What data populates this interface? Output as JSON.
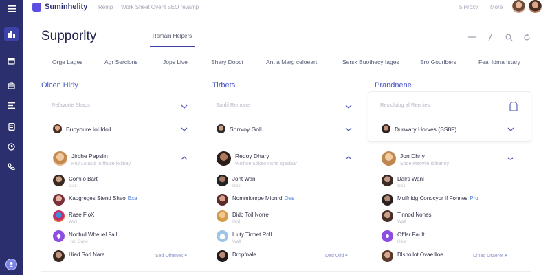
{
  "app": {
    "name": "Suminhelity"
  },
  "topbar": {
    "links": [
      "Remp",
      "Work Sheet Overit SEO revamp"
    ],
    "right_links": [
      "5 Proxy",
      "More"
    ]
  },
  "header": {
    "title": "Supporlty",
    "active_tab": "Remain Helpers"
  },
  "categories": [
    "Orge Lages",
    "Agr Sercions",
    "Jops Live",
    "Shary Dooct",
    "Ant a Marg celoeart",
    "Sersk Buothecy Iages",
    "Sro Gourlbers",
    "Feal Idma Istary"
  ],
  "columns": [
    {
      "title": "Oicen Hirly",
      "search_placeholder": "Refavorte Shaps",
      "selected": "Bupyoure Iol Idoil",
      "lead": {
        "name": "Jirche Pepsiin",
        "sub": "Poy Lolasis Iorlhuse lolilhay"
      },
      "members": [
        {
          "name": "Comilo Bart",
          "sub": "Gall",
          "tag": ""
        },
        {
          "name": "Kaogreges Stend Sheo",
          "sub": "",
          "tag": "Exa"
        },
        {
          "name": "Rase FloX",
          "sub": "Wall",
          "tag": ""
        },
        {
          "name": "Nodfud Wheuel Fall",
          "sub": "Hail Calle",
          "tag": ""
        },
        {
          "name": "Hiad Sod Nare",
          "sub": "",
          "tag": ""
        }
      ],
      "footer_link": "Sed Olhenes"
    },
    {
      "title": "Tirbets",
      "search_placeholder": "Sanfil Remone",
      "selected": "Sorrvoy Goll",
      "lead": {
        "name": "Redoy Dhary",
        "sub": "Wolhce Sokeo Ilwho Igaslaar"
      },
      "members": [
        {
          "name": "Jont Wanl",
          "sub": "Gall",
          "tag": ""
        },
        {
          "name": "Nommionrpe Mionrd",
          "sub": "",
          "tag": "Oas"
        },
        {
          "name": "Dido Toil Norre",
          "sub": "Ierd",
          "tag": ""
        },
        {
          "name": "Liuty Tirmet Roll",
          "sub": "Wall",
          "tag": ""
        },
        {
          "name": "Dropfnale",
          "sub": "",
          "tag": ""
        }
      ],
      "footer_link": "Dad Olld"
    },
    {
      "title": "Prandnene",
      "search_placeholder": "Resiolsiog af Rennies",
      "selected": "Durwary Horves (SS8F)",
      "lead": {
        "name": "Jon Dhny",
        "sub": "Sode Maoyile Iolhanoy"
      },
      "members": [
        {
          "name": "Dalrs Wanl",
          "sub": "Gall",
          "tag": ""
        },
        {
          "name": "Mulfnidg Conocypr If Fonnes",
          "sub": "",
          "tag": "Pro"
        },
        {
          "name": "Tinnod Nones",
          "sub": "Wall",
          "tag": ""
        },
        {
          "name": "Offlar Fault",
          "sub": "Hear",
          "tag": ""
        },
        {
          "name": "Dlsnollot Ovae lloe",
          "sub": "",
          "tag": ""
        }
      ],
      "footer_link": "Dinao Oraeret"
    }
  ],
  "colors": {
    "rail": "#2b2f6e",
    "accent": "#3d42a8",
    "link": "#4a56c8"
  },
  "icons": [
    "menu-icon",
    "dashboard-icon",
    "calendar-icon",
    "briefcase-icon",
    "list-icon",
    "document-icon",
    "clock-icon",
    "phone-icon"
  ]
}
